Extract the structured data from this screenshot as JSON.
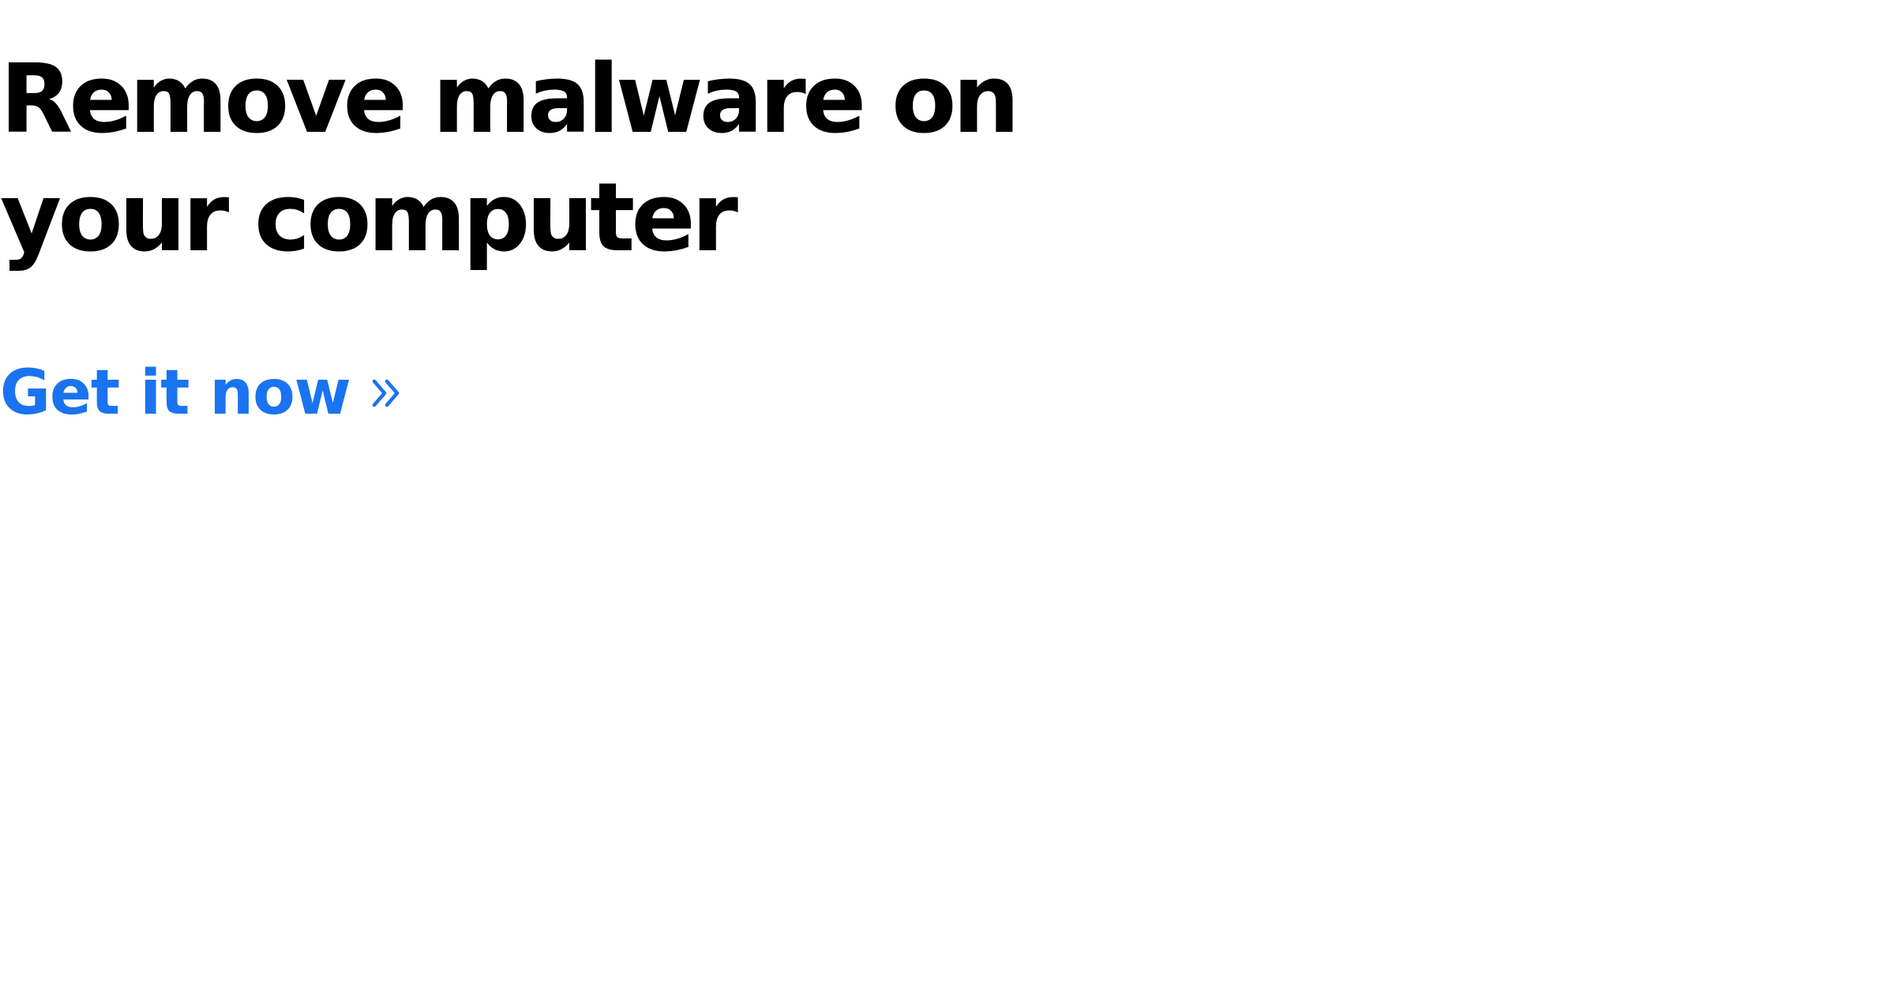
{
  "hero": {
    "title_line_1": "Remove malware on",
    "title_line_2": "your computer"
  },
  "cta": {
    "label": "Get it now",
    "icon": "double-chevron-right-icon"
  },
  "colors": {
    "heading": "#000000",
    "link": "#1a73f0",
    "background": "#ffffff"
  }
}
